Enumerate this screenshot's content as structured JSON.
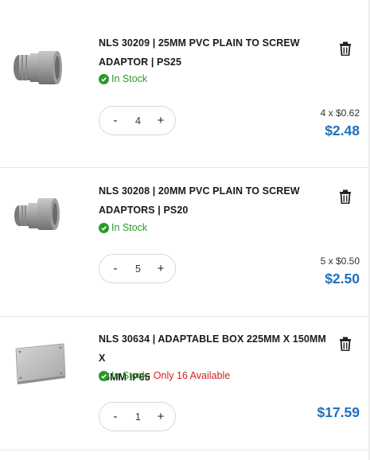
{
  "items": [
    {
      "title_line1": "NLS 30209 | 25MM PVC PLAIN TO SCREW",
      "title_line2": "ADAPTOR | PS25",
      "stock": "In Stock",
      "availability": "",
      "quantity": "4",
      "minus": "-",
      "plus": "+",
      "unit_price": "4 x $0.62",
      "total": "$2.48"
    },
    {
      "title_line1": "NLS 30208 | 20MM PVC PLAIN TO SCREW",
      "title_line2": "ADAPTORS | PS20",
      "stock": "In Stock",
      "availability": "",
      "quantity": "5",
      "minus": "-",
      "plus": "+",
      "unit_price": "5 x $0.50",
      "total": "$2.50"
    },
    {
      "title_line1": "NLS 30634 | ADAPTABLE BOX 225MM X 150MM X",
      "title_line2": "75MM IP65",
      "stock": "In Stock",
      "availability": " - Only 16 Available",
      "quantity": "1",
      "minus": "-",
      "plus": "+",
      "unit_price": "",
      "total": "$17.59"
    }
  ],
  "colors": {
    "price": "#1f6fbd",
    "in_stock": "#2a9a2a",
    "low_stock": "#d32020"
  },
  "icons": [
    "adaptor-thumbnail",
    "adaptable-box-thumbnail",
    "trash-icon",
    "check-circle-icon"
  ]
}
